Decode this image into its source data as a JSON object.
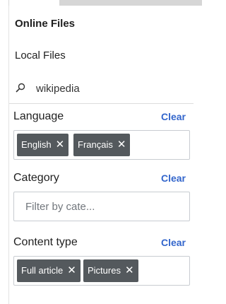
{
  "nav": {
    "online_files": "Online Files",
    "local_files": "Local Files"
  },
  "search": {
    "value": "wikipedia"
  },
  "language": {
    "title": "Language",
    "clear": "Clear",
    "chips": [
      "English",
      "Français"
    ]
  },
  "category": {
    "title": "Category",
    "clear": "Clear",
    "placeholder": "Filter by cate..."
  },
  "content_type": {
    "title": "Content type",
    "clear": "Clear",
    "chips": [
      "Full article",
      "Pictures"
    ]
  },
  "chip_remove_glyph": "✕",
  "colors": {
    "accent": "#3366cc",
    "chip_bg": "#54595d"
  }
}
